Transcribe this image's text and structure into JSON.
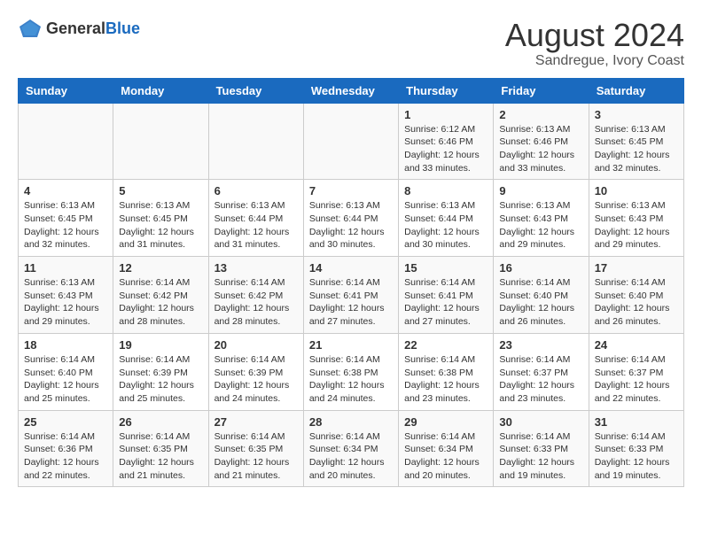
{
  "header": {
    "logo_general": "General",
    "logo_blue": "Blue",
    "title": "August 2024",
    "subtitle": "Sandregue, Ivory Coast"
  },
  "columns": [
    "Sunday",
    "Monday",
    "Tuesday",
    "Wednesday",
    "Thursday",
    "Friday",
    "Saturday"
  ],
  "weeks": [
    [
      {
        "day": "",
        "info": ""
      },
      {
        "day": "",
        "info": ""
      },
      {
        "day": "",
        "info": ""
      },
      {
        "day": "",
        "info": ""
      },
      {
        "day": "1",
        "info": "Sunrise: 6:12 AM\nSunset: 6:46 PM\nDaylight: 12 hours\nand 33 minutes."
      },
      {
        "day": "2",
        "info": "Sunrise: 6:13 AM\nSunset: 6:46 PM\nDaylight: 12 hours\nand 33 minutes."
      },
      {
        "day": "3",
        "info": "Sunrise: 6:13 AM\nSunset: 6:45 PM\nDaylight: 12 hours\nand 32 minutes."
      }
    ],
    [
      {
        "day": "4",
        "info": "Sunrise: 6:13 AM\nSunset: 6:45 PM\nDaylight: 12 hours\nand 32 minutes."
      },
      {
        "day": "5",
        "info": "Sunrise: 6:13 AM\nSunset: 6:45 PM\nDaylight: 12 hours\nand 31 minutes."
      },
      {
        "day": "6",
        "info": "Sunrise: 6:13 AM\nSunset: 6:44 PM\nDaylight: 12 hours\nand 31 minutes."
      },
      {
        "day": "7",
        "info": "Sunrise: 6:13 AM\nSunset: 6:44 PM\nDaylight: 12 hours\nand 30 minutes."
      },
      {
        "day": "8",
        "info": "Sunrise: 6:13 AM\nSunset: 6:44 PM\nDaylight: 12 hours\nand 30 minutes."
      },
      {
        "day": "9",
        "info": "Sunrise: 6:13 AM\nSunset: 6:43 PM\nDaylight: 12 hours\nand 29 minutes."
      },
      {
        "day": "10",
        "info": "Sunrise: 6:13 AM\nSunset: 6:43 PM\nDaylight: 12 hours\nand 29 minutes."
      }
    ],
    [
      {
        "day": "11",
        "info": "Sunrise: 6:13 AM\nSunset: 6:43 PM\nDaylight: 12 hours\nand 29 minutes."
      },
      {
        "day": "12",
        "info": "Sunrise: 6:14 AM\nSunset: 6:42 PM\nDaylight: 12 hours\nand 28 minutes."
      },
      {
        "day": "13",
        "info": "Sunrise: 6:14 AM\nSunset: 6:42 PM\nDaylight: 12 hours\nand 28 minutes."
      },
      {
        "day": "14",
        "info": "Sunrise: 6:14 AM\nSunset: 6:41 PM\nDaylight: 12 hours\nand 27 minutes."
      },
      {
        "day": "15",
        "info": "Sunrise: 6:14 AM\nSunset: 6:41 PM\nDaylight: 12 hours\nand 27 minutes."
      },
      {
        "day": "16",
        "info": "Sunrise: 6:14 AM\nSunset: 6:40 PM\nDaylight: 12 hours\nand 26 minutes."
      },
      {
        "day": "17",
        "info": "Sunrise: 6:14 AM\nSunset: 6:40 PM\nDaylight: 12 hours\nand 26 minutes."
      }
    ],
    [
      {
        "day": "18",
        "info": "Sunrise: 6:14 AM\nSunset: 6:40 PM\nDaylight: 12 hours\nand 25 minutes."
      },
      {
        "day": "19",
        "info": "Sunrise: 6:14 AM\nSunset: 6:39 PM\nDaylight: 12 hours\nand 25 minutes."
      },
      {
        "day": "20",
        "info": "Sunrise: 6:14 AM\nSunset: 6:39 PM\nDaylight: 12 hours\nand 24 minutes."
      },
      {
        "day": "21",
        "info": "Sunrise: 6:14 AM\nSunset: 6:38 PM\nDaylight: 12 hours\nand 24 minutes."
      },
      {
        "day": "22",
        "info": "Sunrise: 6:14 AM\nSunset: 6:38 PM\nDaylight: 12 hours\nand 23 minutes."
      },
      {
        "day": "23",
        "info": "Sunrise: 6:14 AM\nSunset: 6:37 PM\nDaylight: 12 hours\nand 23 minutes."
      },
      {
        "day": "24",
        "info": "Sunrise: 6:14 AM\nSunset: 6:37 PM\nDaylight: 12 hours\nand 22 minutes."
      }
    ],
    [
      {
        "day": "25",
        "info": "Sunrise: 6:14 AM\nSunset: 6:36 PM\nDaylight: 12 hours\nand 22 minutes."
      },
      {
        "day": "26",
        "info": "Sunrise: 6:14 AM\nSunset: 6:35 PM\nDaylight: 12 hours\nand 21 minutes."
      },
      {
        "day": "27",
        "info": "Sunrise: 6:14 AM\nSunset: 6:35 PM\nDaylight: 12 hours\nand 21 minutes."
      },
      {
        "day": "28",
        "info": "Sunrise: 6:14 AM\nSunset: 6:34 PM\nDaylight: 12 hours\nand 20 minutes."
      },
      {
        "day": "29",
        "info": "Sunrise: 6:14 AM\nSunset: 6:34 PM\nDaylight: 12 hours\nand 20 minutes."
      },
      {
        "day": "30",
        "info": "Sunrise: 6:14 AM\nSunset: 6:33 PM\nDaylight: 12 hours\nand 19 minutes."
      },
      {
        "day": "31",
        "info": "Sunrise: 6:14 AM\nSunset: 6:33 PM\nDaylight: 12 hours\nand 19 minutes."
      }
    ]
  ]
}
